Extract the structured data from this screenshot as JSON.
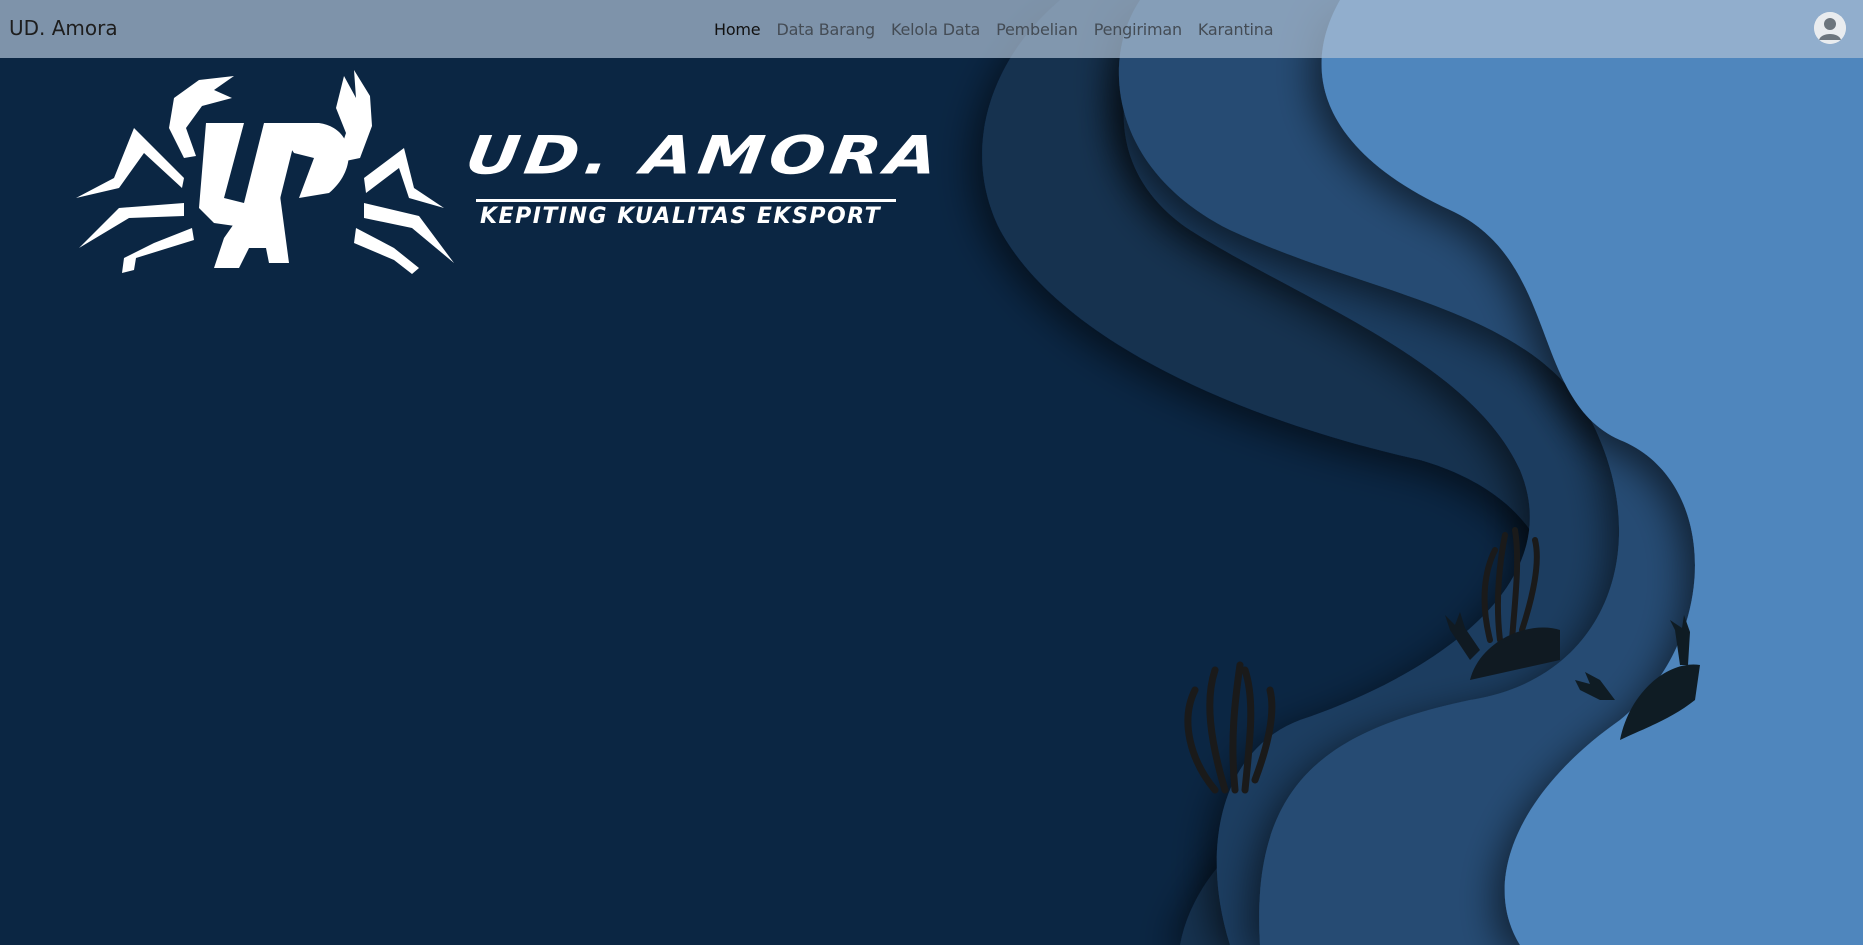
{
  "app": {
    "brand": "UD. Amora"
  },
  "nav": {
    "items": [
      {
        "label": "Home",
        "active": true
      },
      {
        "label": "Data Barang",
        "active": false
      },
      {
        "label": "Kelola Data",
        "active": false
      },
      {
        "label": "Pembelian",
        "active": false
      },
      {
        "label": "Pengiriman",
        "active": false
      },
      {
        "label": "Karantina",
        "active": false
      }
    ]
  },
  "hero": {
    "logo_title": "UD. AMORA",
    "logo_subtitle": "KEPITING KUALITAS EKSPORT",
    "logo_monogram": "UDA"
  },
  "user": {
    "avatar_icon": "user-avatar-icon"
  },
  "colors": {
    "background": "#0b2643",
    "wave_light": "#4f86bd",
    "wave_mid": "#244a6f",
    "wave_dark": "#163a5c",
    "navbar": "#aabed2"
  }
}
